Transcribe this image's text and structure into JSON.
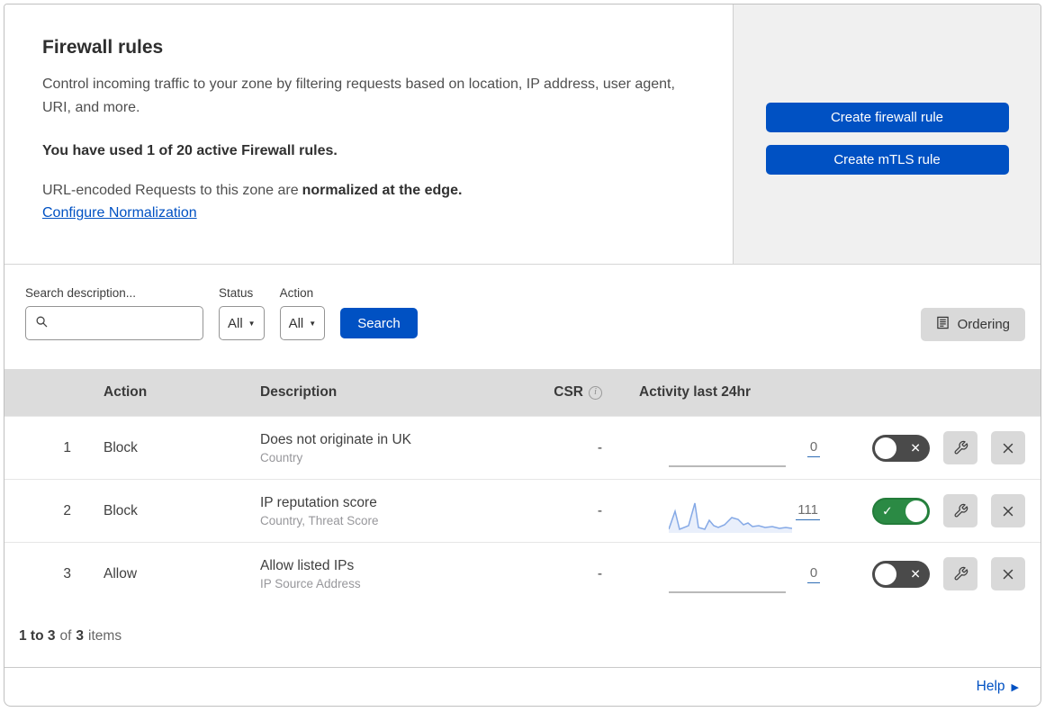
{
  "header": {
    "title": "Firewall rules",
    "description": "Control incoming traffic to your zone by filtering requests based on location, IP address, user agent, URI, and more.",
    "usage_bold": "You have used 1 of 20 active Firewall rules.",
    "normalization_prefix": "URL-encoded Requests to this zone are",
    "normalization_bold": "normalized at the edge.",
    "normalization_link": "Configure Normalization"
  },
  "actions_panel": {
    "create_firewall_label": "Create firewall rule",
    "create_mtls_label": "Create mTLS rule"
  },
  "filters": {
    "search_label": "Search description...",
    "search_value": "",
    "status_label": "Status",
    "status_value": "All",
    "action_label": "Action",
    "action_value": "All",
    "search_button_label": "Search",
    "ordering_button_label": "Ordering"
  },
  "table": {
    "columns": {
      "action": "Action",
      "description": "Description",
      "csr": "CSR",
      "activity": "Activity last 24hr"
    },
    "rows": [
      {
        "priority": "1",
        "action": "Block",
        "description": "Does not originate in UK",
        "fields": "Country",
        "csr": "-",
        "count": "0",
        "enabled": false
      },
      {
        "priority": "2",
        "action": "Block",
        "description": "IP reputation score",
        "fields": "Country, Threat Score",
        "csr": "-",
        "count": "111",
        "enabled": true,
        "sparkline": [
          [
            0,
            3
          ],
          [
            7,
            23
          ],
          [
            12,
            3
          ],
          [
            22,
            7
          ],
          [
            29,
            32
          ],
          [
            33,
            5
          ],
          [
            40,
            3
          ],
          [
            45,
            13
          ],
          [
            50,
            7
          ],
          [
            55,
            5
          ],
          [
            62,
            8
          ],
          [
            70,
            16
          ],
          [
            77,
            14
          ],
          [
            83,
            8
          ],
          [
            88,
            10
          ],
          [
            93,
            6
          ],
          [
            100,
            7
          ],
          [
            107,
            5
          ],
          [
            115,
            6
          ],
          [
            123,
            4
          ],
          [
            130,
            5
          ],
          [
            137,
            4
          ]
        ]
      },
      {
        "priority": "3",
        "action": "Allow",
        "description": "Allow listed IPs",
        "fields": "IP Source Address",
        "csr": "-",
        "count": "0",
        "enabled": false
      }
    ]
  },
  "pagination": {
    "range": "1 to 3",
    "of_word": "of",
    "total": "3",
    "items_word": "items"
  },
  "footer": {
    "help_label": "Help"
  },
  "colors": {
    "accent_blue": "#0051c3",
    "toggle_on_green": "#2b8a44",
    "toggle_off_gray": "#4a4a4a",
    "sparkline_blue": "#85a9e6",
    "table_header_bg": "#dcdcdc",
    "panel_bg": "#f0f0f0"
  }
}
